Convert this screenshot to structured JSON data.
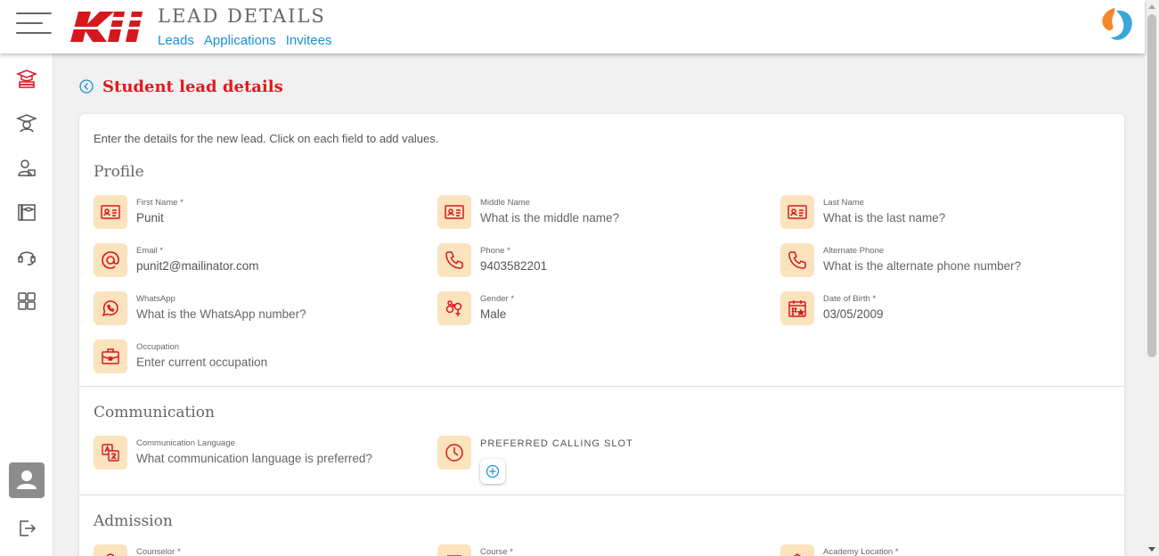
{
  "header": {
    "logo_text": "Kii",
    "title": "LEAD DETAILS",
    "nav": [
      "Leads",
      "Applications",
      "Invitees"
    ]
  },
  "page": {
    "title": "Student lead details",
    "intro": "Enter the details for the new lead. Click on each field to add values."
  },
  "colors": {
    "accent": "#e0191e",
    "link": "#1a90d6",
    "icon_bg": "#fbe3be"
  },
  "profile": {
    "title": "Profile",
    "fields": [
      {
        "label": "First Name *",
        "value": "Punit",
        "icon": "id-card-icon"
      },
      {
        "label": "Middle Name",
        "value": "What is the middle name?",
        "icon": "id-card-icon"
      },
      {
        "label": "Last Name",
        "value": "What is the last name?",
        "icon": "id-card-icon"
      },
      {
        "label": "Email *",
        "value": "punit2@mailinator.com",
        "icon": "at-icon"
      },
      {
        "label": "Phone *",
        "value": "9403582201",
        "icon": "phone-icon"
      },
      {
        "label": "Alternate Phone",
        "value": "What is the alternate phone number?",
        "icon": "phone-icon"
      },
      {
        "label": "WhatsApp",
        "value": "What is the WhatsApp number?",
        "icon": "whatsapp-icon"
      },
      {
        "label": "Gender *",
        "value": "Male",
        "icon": "gender-icon"
      },
      {
        "label": "Date of Birth *",
        "value": "03/05/2009",
        "icon": "calendar-icon"
      },
      {
        "label": "Occupation",
        "value": "Enter current occupation",
        "icon": "briefcase-icon"
      }
    ]
  },
  "communication": {
    "title": "Communication",
    "language_label": "Communication Language",
    "language_value": "What communication language is preferred?",
    "slot_label": "PREFERRED CALLING SLOT"
  },
  "admission": {
    "title": "Admission",
    "fields": [
      {
        "label": "Counselor *"
      },
      {
        "label": "Course *"
      },
      {
        "label": "Academy Location *"
      }
    ]
  }
}
